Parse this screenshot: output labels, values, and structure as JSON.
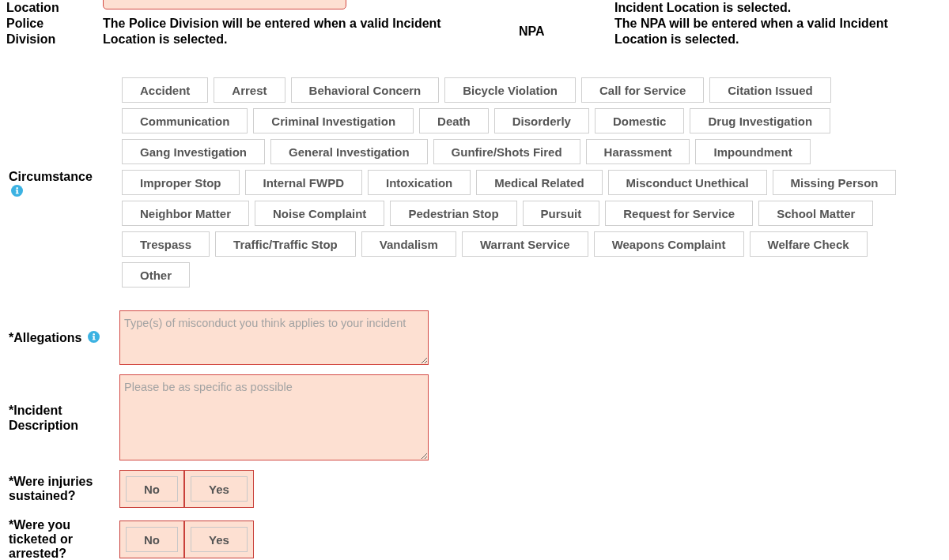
{
  "location_row": {
    "label": "Location",
    "field": {
      "invalid": true
    },
    "note": "Incident Location is selected."
  },
  "division_row": [
    {
      "label": "Police Division",
      "value": "The Police Division will be entered when a valid Incident Location is selected."
    },
    {
      "label": "NPA",
      "value": "The NPA will be entered when a valid Incident Location is selected."
    }
  ],
  "circumstance": {
    "label": "Circumstance",
    "info": true,
    "options": [
      {
        "label": "Accident",
        "selected": false
      },
      {
        "label": "Arrest",
        "selected": false
      },
      {
        "label": "Behavioral Concern",
        "selected": false
      },
      {
        "label": "Bicycle Violation",
        "selected": false
      },
      {
        "label": "Call for Service",
        "selected": false
      },
      {
        "label": "Citation Issued",
        "selected": false
      },
      {
        "label": "Communication",
        "selected": false
      },
      {
        "label": "Criminal Investigation",
        "selected": false
      },
      {
        "label": "Death",
        "selected": false
      },
      {
        "label": "Disorderly",
        "selected": false
      },
      {
        "label": "Domestic",
        "selected": false
      },
      {
        "label": "Drug Investigation",
        "selected": false
      },
      {
        "label": "Gang Investigation",
        "selected": false
      },
      {
        "label": "General Investigation",
        "selected": false
      },
      {
        "label": "Gunfire/Shots Fired",
        "selected": false
      },
      {
        "label": "Harassment",
        "selected": false
      },
      {
        "label": "Impoundment",
        "selected": false
      },
      {
        "label": "Improper Stop",
        "selected": false
      },
      {
        "label": "Internal FWPD",
        "selected": false
      },
      {
        "label": "Intoxication",
        "selected": false
      },
      {
        "label": "Medical Related",
        "selected": false
      },
      {
        "label": "Misconduct Unethical",
        "selected": false
      },
      {
        "label": "Missing Person",
        "selected": false
      },
      {
        "label": "Neighbor Matter",
        "selected": false
      },
      {
        "label": "Noise Complaint",
        "selected": false
      },
      {
        "label": "Pedestrian Stop",
        "selected": false
      },
      {
        "label": "Pursuit",
        "selected": false
      },
      {
        "label": "Request for Service",
        "selected": false
      },
      {
        "label": "School Matter",
        "selected": false
      },
      {
        "label": "Trespass",
        "selected": false
      },
      {
        "label": "Traffic/Traffic Stop",
        "selected": false
      },
      {
        "label": "Vandalism",
        "selected": false
      },
      {
        "label": "Warrant Service",
        "selected": false
      },
      {
        "label": "Weapons Complaint",
        "selected": false
      },
      {
        "label": "Welfare Check",
        "selected": false
      },
      {
        "label": "Other",
        "selected": false
      }
    ]
  },
  "allegations": {
    "label": "*Allegations",
    "info": true,
    "placeholder": "Type(s) of misconduct you think applies to your incident",
    "invalid": true
  },
  "incident_description": {
    "label": "*Incident Description",
    "placeholder": "Please be as specific as possible",
    "invalid": true
  },
  "questions": [
    {
      "label": "*Were injuries sustained?",
      "invalid": true,
      "options": [
        {
          "label": "No",
          "selected": false
        },
        {
          "label": "Yes",
          "selected": false
        }
      ]
    },
    {
      "label": "*Were you ticketed or arrested?",
      "invalid": true,
      "options": [
        {
          "label": "No",
          "selected": false
        },
        {
          "label": "Yes",
          "selected": false
        }
      ]
    }
  ]
}
